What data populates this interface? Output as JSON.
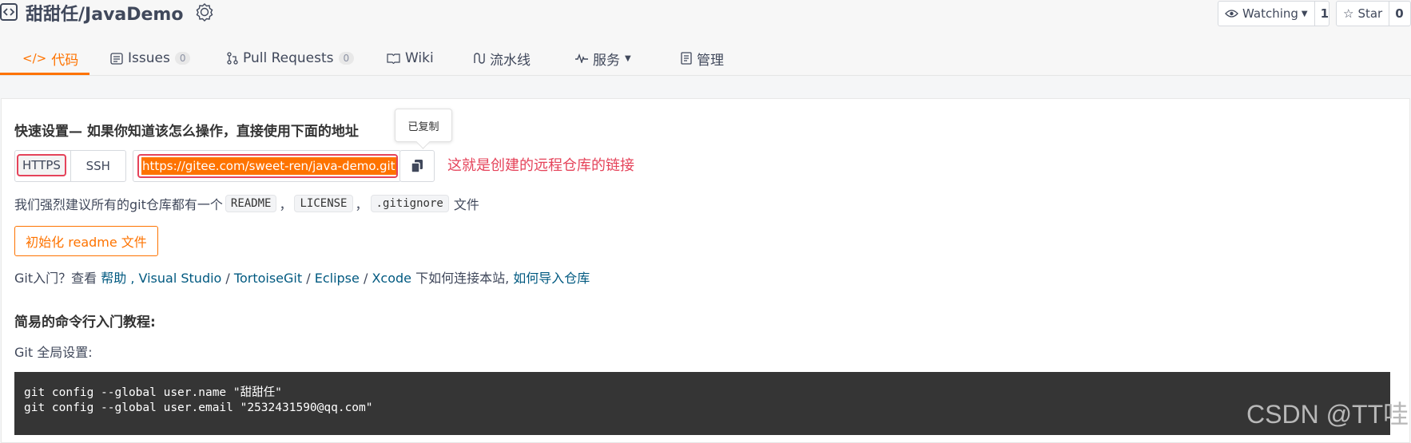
{
  "repo": {
    "title": "甜甜任/JavaDemo",
    "watch_label": "Watching",
    "watch_count": "1",
    "star_label": "Star",
    "star_count": "0"
  },
  "tabs": [
    {
      "label": "代码",
      "icon": "code-icon",
      "active": true
    },
    {
      "label": "Issues",
      "count": "0",
      "icon": "issues-icon"
    },
    {
      "label": "Pull Requests",
      "count": "0",
      "icon": "pull-request-icon"
    },
    {
      "label": "Wiki",
      "icon": "wiki-icon"
    },
    {
      "label": "流水线",
      "icon": "pipeline-icon"
    },
    {
      "label": "服务",
      "icon": "service-icon",
      "dropdown": true
    },
    {
      "label": "管理",
      "icon": "manage-icon"
    }
  ],
  "quick_setup": {
    "heading": "快速设置— 如果你知道该怎么操作，直接使用下面的地址",
    "protocol_https": "HTTPS",
    "protocol_ssh": "SSH",
    "url": "https://gitee.com/sweet-ren/java-demo.git",
    "copied_tooltip": "已复制",
    "annotation": "这就是创建的远程仓库的链接"
  },
  "recommend": {
    "prefix": "我们强烈建议所有的git仓库都有一个",
    "readme": "README",
    "license": "LICENSE",
    "gitignore": ".gitignore",
    "sep1": "，",
    "sep2": "，",
    "suffix": "文件"
  },
  "init_button": "初始化 readme 文件",
  "git_intro": {
    "prefix": "Git入门？查看",
    "help": "帮助",
    "sep0": ",",
    "visual_studio": "Visual Studio",
    "sep1": "/",
    "tortoisegit": "TortoiseGit",
    "sep2": "/",
    "eclipse": "Eclipse",
    "sep3": "/",
    "xcode": "Xcode",
    "middle": "下如何连接本站,",
    "import": "如何导入仓库"
  },
  "tutorial": {
    "heading": "简易的命令行入门教程:",
    "global_label": "Git 全局设置:",
    "code_lines": [
      "git config --global user.name \"甜甜任\"",
      "git config --global user.email \"2532431590@qq.com\""
    ]
  },
  "watermark": "CSDN @TT哇",
  "colors": {
    "accent": "#fe7300",
    "highlight_red": "#e5435a",
    "link": "#005980",
    "code_bg": "#353535"
  }
}
